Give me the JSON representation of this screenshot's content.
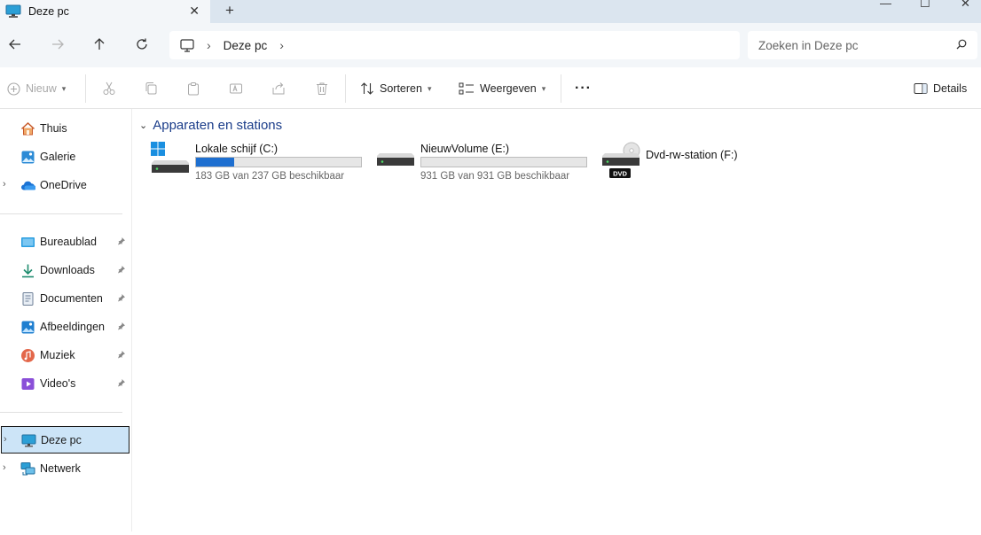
{
  "tab": {
    "title": "Deze pc",
    "close_glyph": "✕",
    "new_tab_glyph": "+"
  },
  "window_controls": {
    "minimize": "—",
    "maximize": "☐",
    "close": "✕"
  },
  "address": {
    "breadcrumbs": [
      "Deze pc"
    ],
    "separator": "›"
  },
  "search": {
    "placeholder": "Zoeken in Deze pc"
  },
  "commands": {
    "new_label": "Nieuw",
    "sort_label": "Sorteren",
    "view_label": "Weergeven",
    "more_glyph": "···",
    "details_label": "Details"
  },
  "sidebar": {
    "top": [
      {
        "label": "Thuis",
        "icon": "home-icon"
      },
      {
        "label": "Galerie",
        "icon": "gallery-icon"
      },
      {
        "label": "OneDrive",
        "icon": "onedrive-icon"
      }
    ],
    "quick_access": [
      {
        "label": "Bureaublad",
        "icon": "desktop-folder-icon"
      },
      {
        "label": "Downloads",
        "icon": "downloads-icon"
      },
      {
        "label": "Documenten",
        "icon": "documents-icon"
      },
      {
        "label": "Afbeeldingen",
        "icon": "pictures-icon"
      },
      {
        "label": "Muziek",
        "icon": "music-icon"
      },
      {
        "label": "Video's",
        "icon": "videos-icon"
      }
    ],
    "bottom": [
      {
        "label": "Deze pc",
        "icon": "this-pc-icon",
        "selected": true
      },
      {
        "label": "Netwerk",
        "icon": "network-icon"
      }
    ]
  },
  "content": {
    "group_title": "Apparaten en stations",
    "drives": [
      {
        "name": "Lokale schijf (C:)",
        "info": "183 GB van 237 GB beschikbaar",
        "used_fraction": 0.23,
        "icon": "system-drive-icon"
      },
      {
        "name": "NieuwVolume (E:)",
        "info": "931 GB van 931 GB beschikbaar",
        "used_fraction": 0.0,
        "icon": "hard-drive-icon"
      },
      {
        "name": "Dvd-rw-station (F:)",
        "badge": "DVD",
        "icon": "dvd-drive-icon"
      }
    ]
  },
  "colors": {
    "accent": "#1e6fd0",
    "selection": "#cce4f7",
    "group_header": "#1b3d8a"
  }
}
